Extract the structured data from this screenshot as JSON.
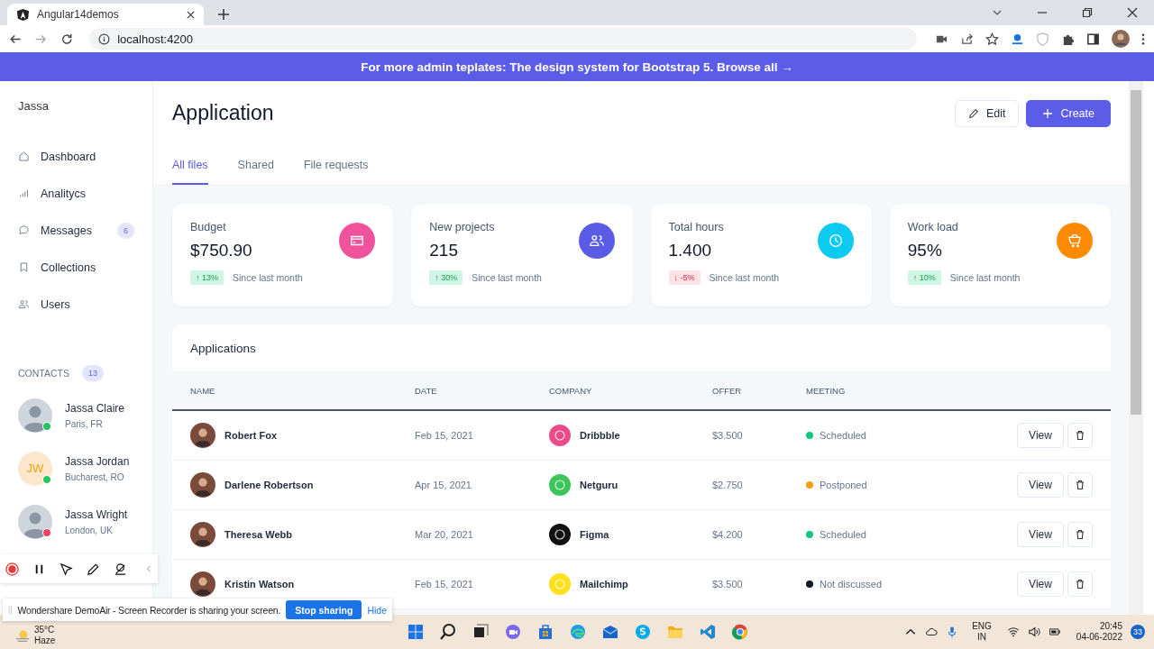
{
  "browser": {
    "tab_title": "Angular14demos",
    "url": "localhost:4200"
  },
  "banner": {
    "text": "For more admin teplates: The design system for Bootstrap 5. Browse all →"
  },
  "sidebar": {
    "brand": "Jassa",
    "items": [
      {
        "label": "Dashboard"
      },
      {
        "label": "Analitycs"
      },
      {
        "label": "Messages",
        "badge": "6"
      },
      {
        "label": "Collections"
      },
      {
        "label": "Users"
      }
    ],
    "contacts_title": "CONTACTS",
    "contacts_count": "13",
    "contacts": [
      {
        "name": "Jassa Claire",
        "location": "Paris, FR",
        "color": "#22c55e"
      },
      {
        "name": "Jassa Jordan",
        "location": "Bucharest, RO",
        "initials": "JW",
        "color": "#22c55e"
      },
      {
        "name": "Jassa Wright",
        "location": "London, UK",
        "color": "#f43f5e"
      }
    ]
  },
  "page": {
    "title": "Application",
    "buttons": [
      {
        "label": "Edit",
        "kind": "secondary"
      },
      {
        "label": "Create",
        "kind": "primary"
      }
    ],
    "tabs": [
      {
        "label": "All files",
        "selected": true
      },
      {
        "label": "Shared",
        "selected": false
      },
      {
        "label": "File requests",
        "selected": false
      }
    ]
  },
  "stats": [
    {
      "label": "Budget",
      "value": "$750.90",
      "change": "↑ 13%",
      "kind": "up",
      "note": "Since last month",
      "color": "#f0529c"
    },
    {
      "label": "New projects",
      "value": "215",
      "change": "↑ 30%",
      "kind": "up",
      "note": "Since last month",
      "color": "#5b5ce6"
    },
    {
      "label": "Total hours",
      "value": "1.400",
      "change": "↓ -5%",
      "kind": "down",
      "note": "Since last month",
      "color": "#0dcaf0"
    },
    {
      "label": "Work load",
      "value": "95%",
      "change": "↑ 10%",
      "kind": "up",
      "note": "Since last month",
      "color": "#fd8a03"
    }
  ],
  "applications": {
    "title": "Applications",
    "columns": [
      "NAME",
      "DATE",
      "COMPANY",
      "OFFER",
      "MEETING"
    ],
    "rows": [
      {
        "name": "Robert Fox",
        "date": "Feb 15, 2021",
        "company": {
          "name": "Dribbble",
          "color": "#ea4c89"
        },
        "offer": "$3.500",
        "meeting": {
          "label": "Scheduled",
          "color": "#10c783"
        },
        "action": "View"
      },
      {
        "name": "Darlene Robertson",
        "date": "Apr 15, 2021",
        "company": {
          "name": "Netguru",
          "color": "#3cc65a"
        },
        "offer": "$2.750",
        "meeting": {
          "label": "Postponed",
          "color": "#f59e0b"
        },
        "action": "View"
      },
      {
        "name": "Theresa Webb",
        "date": "Mar 20, 2021",
        "company": {
          "name": "Figma",
          "color": "#111111"
        },
        "offer": "$4.200",
        "meeting": {
          "label": "Scheduled",
          "color": "#10c783"
        },
        "action": "View"
      },
      {
        "name": "Kristin Watson",
        "date": "Feb 15, 2021",
        "company": {
          "name": "Mailchimp",
          "color": "#ffe01b"
        },
        "offer": "$3.500",
        "meeting": {
          "label": "Not discussed",
          "color": "#111827"
        },
        "action": "View"
      }
    ]
  },
  "recorder": {
    "share_message": "Wondershare DemoAir - Screen Recorder is sharing your screen.",
    "stop_button": "Stop sharing",
    "hide_link": "Hide"
  },
  "taskbar": {
    "temperature": "35°C",
    "weather": "Haze",
    "language": "ENG",
    "region": "IN",
    "time": "20:45",
    "date": "04-06-2022",
    "notifications": "33"
  }
}
